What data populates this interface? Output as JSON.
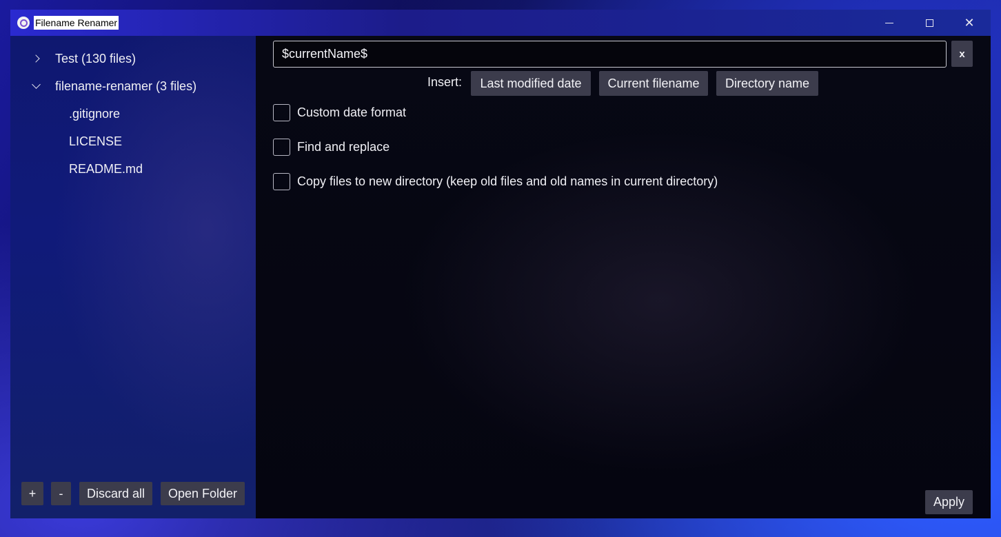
{
  "window": {
    "title": "Filename Renamer"
  },
  "sidebar": {
    "tree": [
      {
        "label": "Test (130 files)",
        "expanded": false
      },
      {
        "label": "filename-renamer (3 files)",
        "expanded": true,
        "children": [
          ".gitignore",
          "LICENSE",
          "README.md"
        ]
      }
    ],
    "buttons": {
      "add": "+",
      "remove": "-",
      "discard_all": "Discard all",
      "open_folder": "Open Folder"
    }
  },
  "main": {
    "name_pattern": "$currentName$",
    "clear_label": "x",
    "insert_label": "Insert:",
    "insert_buttons": [
      "Last modified date",
      "Current filename",
      "Directory name"
    ],
    "options": [
      {
        "label": "Custom date format",
        "checked": false
      },
      {
        "label": "Find and replace",
        "checked": false
      },
      {
        "label": "Copy files to new directory (keep old files and old names in current directory)",
        "checked": false
      }
    ],
    "apply_label": "Apply"
  }
}
